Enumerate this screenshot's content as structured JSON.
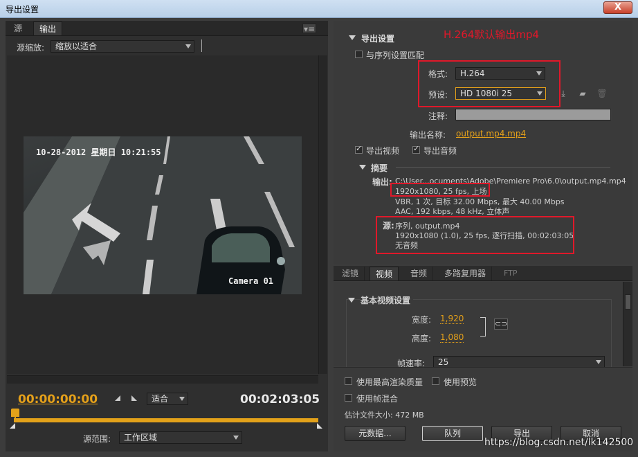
{
  "window": {
    "title": "导出设置",
    "close": "X"
  },
  "left": {
    "tabs": [
      "源",
      "输出"
    ],
    "scale_label": "源缩放:",
    "scale_value": "缩放以适合",
    "osd_time": "10-28-2012 星期日 10:21:55",
    "osd_camera": "Camera 01",
    "timecode_start": "00:00:00:00",
    "timecode_end": "00:02:03:05",
    "fit_value": "适合",
    "range_label": "源范围:",
    "range_value": "工作区域"
  },
  "export": {
    "section_title": "导出设置",
    "annotation": "H.264默认输出mp4",
    "match_sequence": "与序列设置匹配",
    "format_label": "格式:",
    "format_value": "H.264",
    "preset_label": "预设:",
    "preset_value": "HD 1080i 25",
    "comment_label": "注释:",
    "output_name_label": "输出名称:",
    "output_name_value": "output.mp4.mp4",
    "export_video": "导出视频",
    "export_audio": "导出音频",
    "summary_title": "摘要",
    "output_label": "输出:",
    "output_path": "C:\\User...ocuments\\Adobe\\Premiere Pro\\6.0\\output.mp4.mp4",
    "output_line1": "1920x1080, 25 fps, 上场",
    "output_line2": "VBR, 1 次, 目标 32.00 Mbps, 最大 40.00  Mbps",
    "output_line3": "AAC, 192 kbps, 48 kHz, 立体声",
    "source_label": "源:",
    "source_line0": "序列, output.mp4",
    "source_line1": "1920x1080 (1.0), 25 fps, 逐行扫描, 00:02:03:05",
    "source_line2": "无音频"
  },
  "tabs2": [
    "滤镜",
    "视频",
    "音频",
    "多路复用器",
    "FTP"
  ],
  "video": {
    "section_title": "基本视频设置",
    "width_label": "宽度:",
    "width_value": "1,920",
    "height_label": "高度:",
    "height_value": "1,080",
    "fps_label": "帧速率:",
    "fps_value": "25"
  },
  "bottom": {
    "max_render": "使用最高渲染质量",
    "use_preview": "使用预览",
    "frame_blend": "使用帧混合",
    "est_size": "估计文件大小: 472 MB",
    "metadata_btn": "元数据...",
    "queue_btn": "队列",
    "export_btn": "导出",
    "cancel_btn": "取消"
  },
  "watermark": "https://blog.csdn.net/lk142500",
  "colors": {
    "accent": "#e4a01a",
    "annotation": "#e0182a"
  }
}
